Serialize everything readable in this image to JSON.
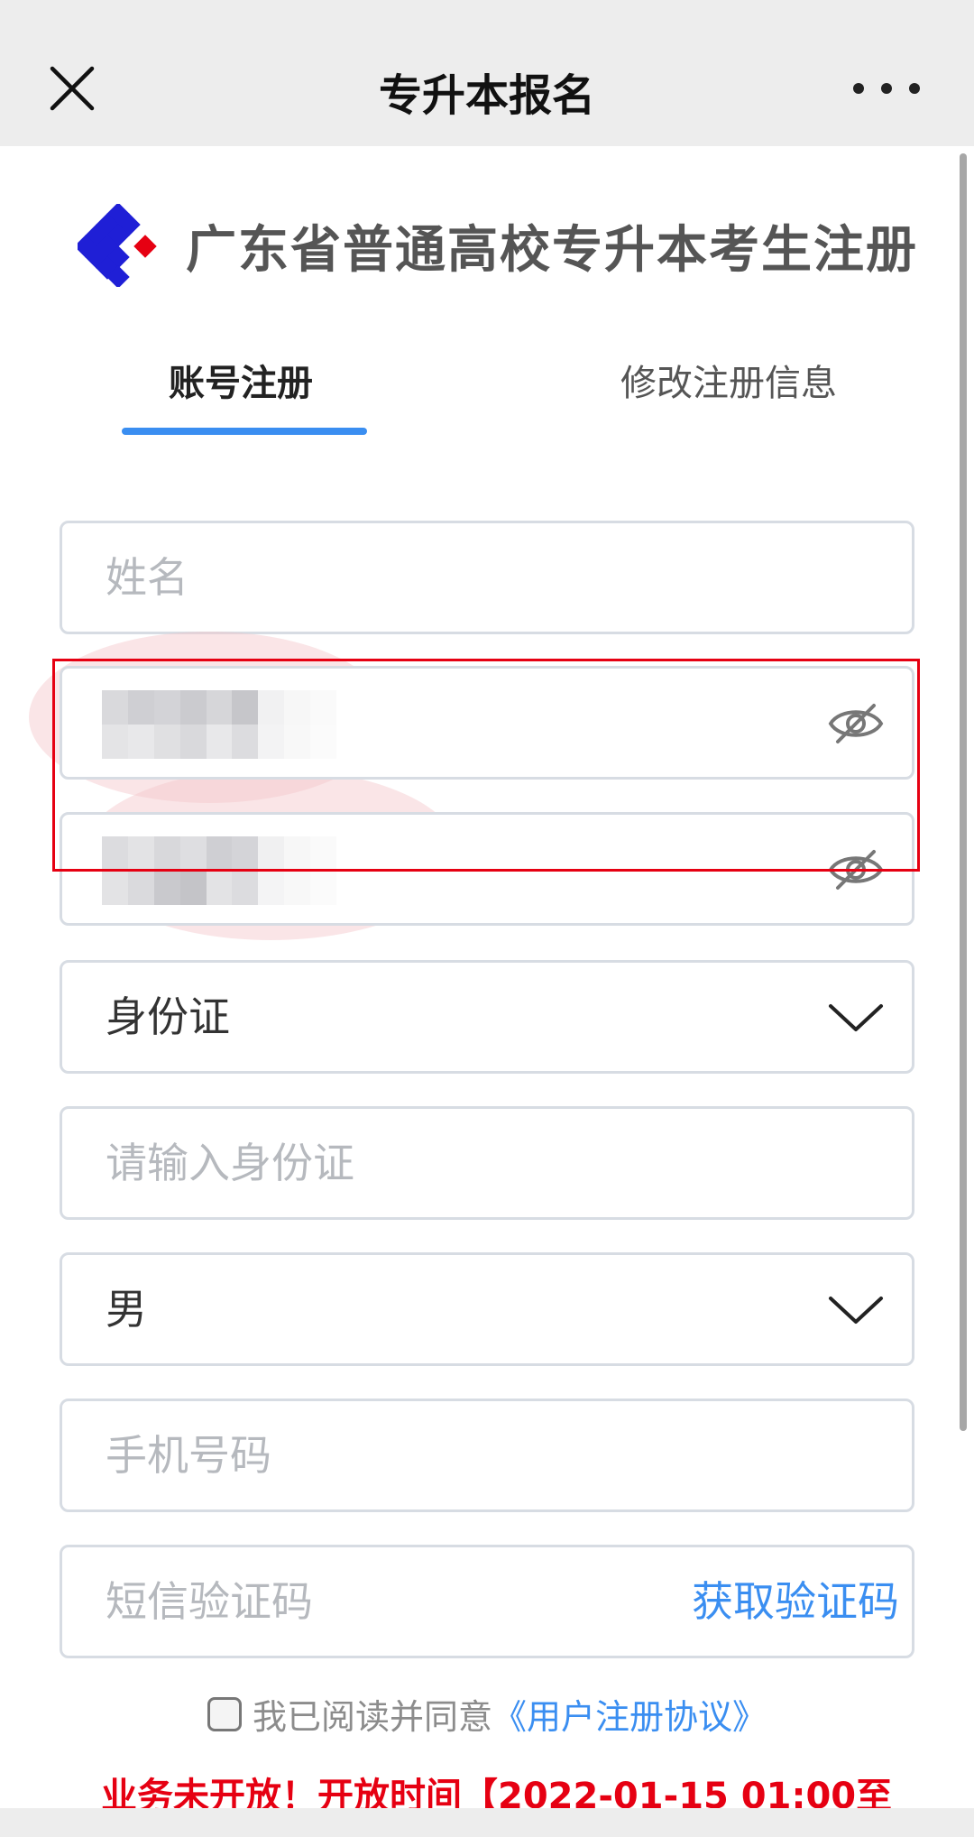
{
  "nav": {
    "title": "专升本报名",
    "close_icon": "close-icon",
    "more_icon": "more-dots-icon"
  },
  "header": {
    "title": "广东省普通高校专升本考生注册",
    "logo_colors": {
      "blue": "#1f1fd6",
      "red": "#e60012"
    }
  },
  "tabs": [
    {
      "label": "账号注册",
      "active": true
    },
    {
      "label": "修改注册信息",
      "active": false
    }
  ],
  "form": {
    "name": {
      "placeholder": "姓名"
    },
    "id_type": {
      "value": "身份证"
    },
    "id_number": {
      "placeholder": "请输入身份证"
    },
    "gender": {
      "value": "男"
    },
    "phone": {
      "placeholder": "手机号码"
    },
    "sms": {
      "placeholder": "短信验证码",
      "action": "获取验证码"
    }
  },
  "agreement": {
    "prefix": "我已阅读并同意",
    "link": "《用户注册协议》",
    "checked": false
  },
  "notice": "业务未开放！开放时间【2022-01-15 01:00至",
  "colors": {
    "accent": "#3a8ef1",
    "alert": "#e60012"
  }
}
